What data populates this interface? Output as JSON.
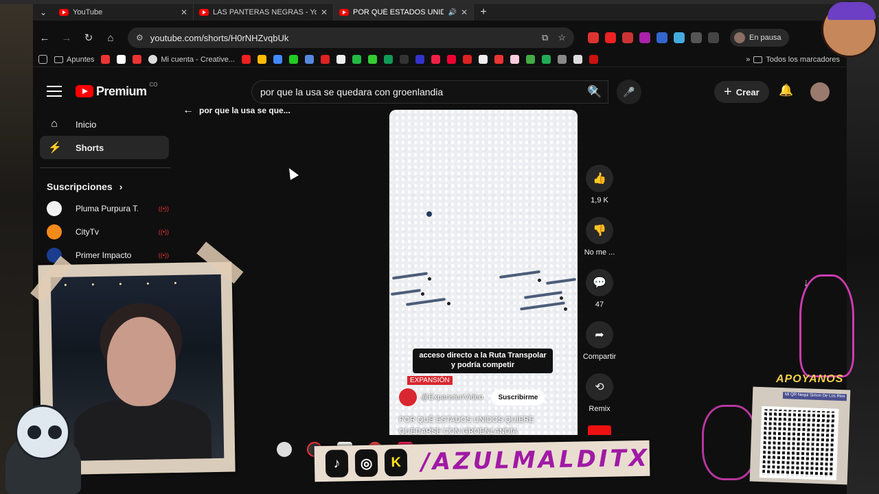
{
  "browser": {
    "tabs": [
      {
        "title": "YouTube",
        "active": false
      },
      {
        "title": "LAS PANTERAS NEGRAS - YouT",
        "active": false
      },
      {
        "title": "POR QUÉ ESTADOS UNIDO",
        "active": true
      }
    ],
    "url": "youtube.com/shorts/H0rNHZvqbUk",
    "profile_label": "En pausa",
    "bookmarks": [
      "Apuntes",
      "Mi cuenta - Creative..."
    ],
    "all_bookmarks_label": "Todos los marcadores"
  },
  "youtube": {
    "logo_text": "Premium",
    "logo_country": "CO",
    "search_query": "por que la usa se quedara con groenlandia",
    "create_label": "Crear",
    "back_label": "por que la usa se que...",
    "sidebar": {
      "items": [
        {
          "label": "Inicio",
          "icon": "home-icon",
          "active": false
        },
        {
          "label": "Shorts",
          "icon": "shorts-icon",
          "active": true
        }
      ],
      "subscriptions_title": "Suscripciones",
      "channels": [
        {
          "name": "Pluma Purpura T...",
          "color": "#f2f2f2"
        },
        {
          "name": "CityTv",
          "color": "#f28a1a"
        },
        {
          "name": "Primer Impacto",
          "color": "#1b3d8f"
        }
      ]
    },
    "short": {
      "caption": "acceso directo a la Ruta Transpolar y podría competir",
      "label": "EXPANSIÓN",
      "channel": "@ExpansionVideo",
      "subscribe_label": "Suscribirme",
      "title": "POR QUÉ ESTADOS UNIDOS QUIERE QUEDARSE CON GROENLANDIA"
    },
    "actions": {
      "likes": "1,9 K",
      "dislike_label": "No me ...",
      "comments": "47",
      "share_label": "Compartir",
      "remix_label": "Remix"
    }
  },
  "overlay": {
    "brand": "/AZULMALDITX",
    "support_label": "APOYANOS",
    "qr_note": "Mi QR Nequi Simon De Los Rios"
  },
  "colors": {
    "youtube_red": "#ff0000",
    "brand_purple": "#a01aa5",
    "devil_pink": "#e040c0"
  }
}
